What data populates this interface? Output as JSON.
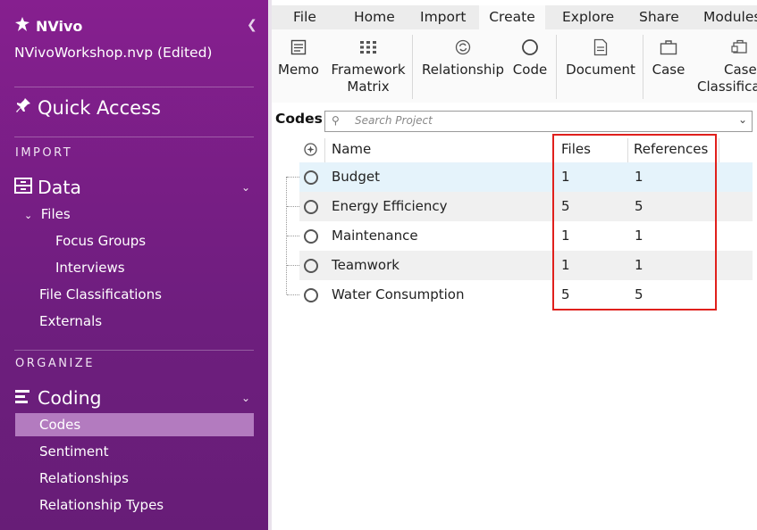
{
  "app": {
    "name": "NVivo",
    "project": "NVivoWorkshop.nvp (Edited)"
  },
  "sidebar": {
    "quick_access": "Quick Access",
    "import_header": "IMPORT",
    "data_label": "Data",
    "files_label": "Files",
    "focus_groups": "Focus Groups",
    "interviews": "Interviews",
    "file_classifications": "File Classifications",
    "externals": "Externals",
    "organize_header": "ORGANIZE",
    "coding_label": "Coding",
    "codes": "Codes",
    "sentiment": "Sentiment",
    "relationships": "Relationships",
    "relationship_types": "Relationship Types"
  },
  "ribbon": {
    "tabs": [
      "File",
      "Home",
      "Import",
      "Create",
      "Explore",
      "Share",
      "Modules"
    ],
    "active_tab": "Create",
    "buttons": {
      "memo": "Memo",
      "framework_1": "Framework",
      "framework_2": "Matrix",
      "relationship": "Relationship",
      "code": "Code",
      "document": "Document",
      "case": "Case",
      "case_class_1": "Case",
      "case_class_2": "Classifica"
    }
  },
  "codes_panel": {
    "title": "Codes",
    "search_placeholder": "Search Project",
    "columns": {
      "name": "Name",
      "files": "Files",
      "references": "References"
    },
    "rows": [
      {
        "name": "Budget",
        "files": "1",
        "references": "1"
      },
      {
        "name": "Energy Efficiency",
        "files": "5",
        "references": "5"
      },
      {
        "name": "Maintenance",
        "files": "1",
        "references": "1"
      },
      {
        "name": "Teamwork",
        "files": "1",
        "references": "1"
      },
      {
        "name": "Water Consumption",
        "files": "5",
        "references": "5"
      }
    ]
  },
  "colors": {
    "sidebar_top": "#861f8f",
    "sidebar_bottom": "#671d77",
    "selected_nav": "#b37bbf",
    "highlight_border": "#e0201c",
    "selected_row": "#e5f3fb",
    "alt_row": "#f0f0f0"
  }
}
